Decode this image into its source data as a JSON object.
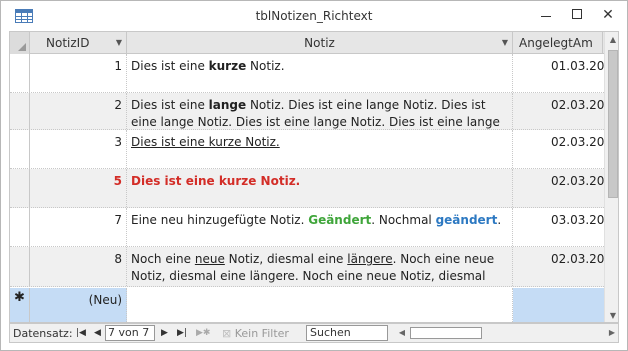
{
  "window": {
    "title": "tblNotizen_Richtext",
    "minimize_icon": "minimize-icon",
    "maximize_icon": "maximize-icon",
    "close_icon": "close-icon",
    "close_label": "✕"
  },
  "columns": {
    "c1": "NotizID",
    "c2": "Notiz",
    "c3": "AngelegtAm"
  },
  "rows": [
    {
      "id": "1",
      "parts": [
        {
          "t": "Dies ist eine ",
          "s": ""
        },
        {
          "t": "kurze",
          "s": "b"
        },
        {
          "t": " Notiz.",
          "s": ""
        }
      ],
      "date": "01.03.20"
    },
    {
      "id": "2",
      "parts": [
        {
          "t": "Dies ist eine ",
          "s": ""
        },
        {
          "t": "lange",
          "s": "b"
        },
        {
          "t": " Notiz. Dies ist eine lange Notiz. Dies ist eine lange Notiz. Dies ist eine lange Notiz. Dies ist eine lange Notiz.",
          "s": ""
        }
      ],
      "date": "02.03.20"
    },
    {
      "id": "3",
      "parts": [
        {
          "t": "Dies ist eine kurze Notiz.",
          "s": "u"
        }
      ],
      "date": "02.03.20"
    },
    {
      "id": "5",
      "id_style": "red",
      "parts": [
        {
          "t": "Dies ist eine kurze Notiz.",
          "s": "red"
        }
      ],
      "date": "02.03.20"
    },
    {
      "id": "7",
      "parts": [
        {
          "t": "Eine neu hinzugefügte Notiz. ",
          "s": ""
        },
        {
          "t": "Geändert",
          "s": "green"
        },
        {
          "t": ". Nochmal ",
          "s": ""
        },
        {
          "t": "geändert",
          "s": "blue"
        },
        {
          "t": ".",
          "s": ""
        }
      ],
      "date": "03.03.20"
    },
    {
      "id": "8",
      "parts": [
        {
          "t": "Noch eine ",
          "s": ""
        },
        {
          "t": "neue",
          "s": "u"
        },
        {
          "t": " Notiz, diesmal eine ",
          "s": ""
        },
        {
          "t": "längere",
          "s": "u"
        },
        {
          "t": ". Noch eine neue Notiz, diesmal eine längere. Noch eine neue Notiz, diesmal",
          "s": ""
        }
      ],
      "date": "02.03.20"
    }
  ],
  "new_row": {
    "marker": "✱",
    "label": "(Neu)"
  },
  "navbar": {
    "label": "Datensatz:",
    "record": "7 von 7",
    "filter_label": "Kein Filter",
    "search_placeholder": "Suchen"
  }
}
